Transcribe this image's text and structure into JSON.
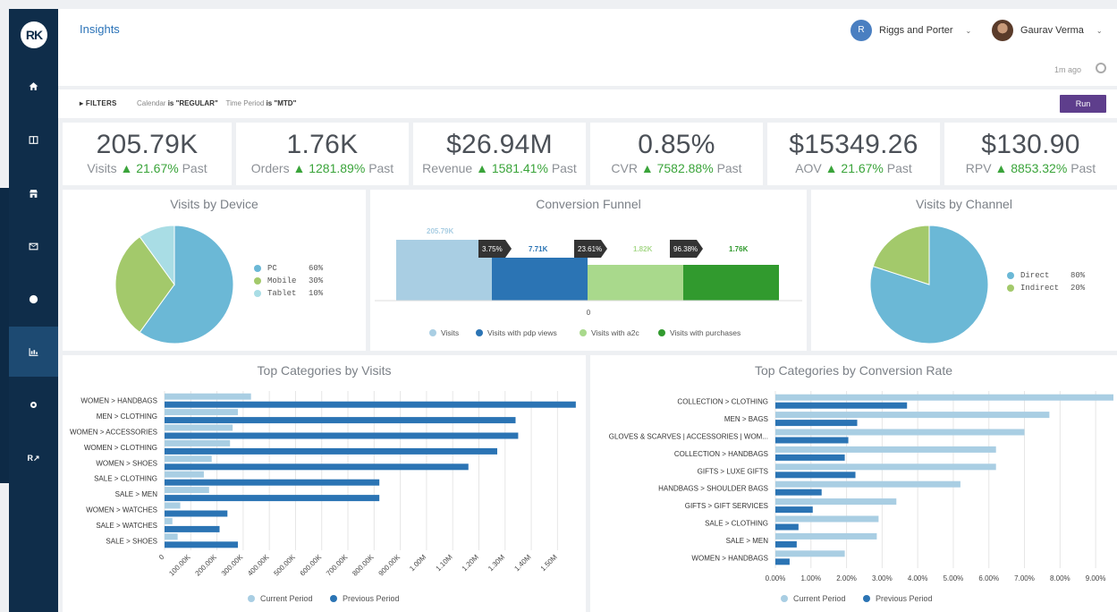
{
  "app": {
    "logo": "RK",
    "page_title": "Insights",
    "account_initial": "R",
    "account_name": "Riggs and Porter",
    "user_name": "Gaurav Verma",
    "updated": "1m ago"
  },
  "sidebar": {
    "items": [
      {
        "icon": "home-icon"
      },
      {
        "icon": "dashboard-icon"
      },
      {
        "icon": "store-icon"
      },
      {
        "icon": "mail-icon"
      },
      {
        "icon": "globe-icon"
      },
      {
        "icon": "chart-icon"
      },
      {
        "icon": "gear-icon"
      },
      {
        "icon": "report-link-icon",
        "label": "R↗"
      }
    ]
  },
  "filters": {
    "label": "FILTERS",
    "calendar_label": "Calendar",
    "calendar_is": "is \"REGULAR\"",
    "period_label": "Time Period",
    "period_is": "is \"MTD\"",
    "run_label": "Run"
  },
  "kpis": [
    {
      "value": "205.79K",
      "label": "Visits",
      "delta": "▲ 21.67%",
      "suffix": "Past"
    },
    {
      "value": "1.76K",
      "label": "Orders",
      "delta": "▲ 1281.89%",
      "suffix": "Past"
    },
    {
      "value": "$26.94M",
      "label": "Revenue",
      "delta": "▲ 1581.41%",
      "suffix": "Past"
    },
    {
      "value": "0.85%",
      "label": "CVR",
      "delta": "▲ 7582.88%",
      "suffix": "Past"
    },
    {
      "value": "$15349.26",
      "label": "AOV",
      "delta": "▲ 21.67%",
      "suffix": "Past"
    },
    {
      "value": "$130.90",
      "label": "RPV",
      "delta": "▲ 8853.32%",
      "suffix": "Past"
    }
  ],
  "colors": {
    "light_blue": "#a9cee3",
    "blue": "#2b74b4",
    "light_green": "#a9d98c",
    "green": "#319a2e",
    "pie_blue": "#6bb8d6",
    "pie_green": "#a3c96b",
    "pie_light": "#a9dde5",
    "up": "#3aa43a"
  },
  "chart_data": [
    {
      "type": "pie",
      "title": "Visits by Device",
      "slices": [
        {
          "name": "PC",
          "pct": "60%",
          "value": 60
        },
        {
          "name": "Mobile",
          "pct": "30%",
          "value": 30
        },
        {
          "name": "Tablet",
          "pct": "10%",
          "value": 10
        }
      ]
    },
    {
      "type": "bar",
      "title": "Conversion Funnel",
      "categories": [
        "Visits",
        "Visits with pdp views",
        "Visits with a2c",
        "Visits with purchases"
      ],
      "value_labels": [
        "205.79K",
        "7.71K",
        "1.82K",
        "1.76K"
      ],
      "rates": [
        "3.75%",
        "23.61%",
        "96.38%"
      ],
      "axis_zero": "0"
    },
    {
      "type": "pie",
      "title": "Visits by Channel",
      "slices": [
        {
          "name": "Direct",
          "pct": "80%",
          "value": 80
        },
        {
          "name": "Indirect",
          "pct": "20%",
          "value": 20
        }
      ]
    },
    {
      "type": "bar",
      "orientation": "horizontal",
      "title": "Top Categories by Visits",
      "categories": [
        "WOMEN > HANDBAGS",
        "MEN > CLOTHING",
        "WOMEN > ACCESSORIES",
        "WOMEN > CLOTHING",
        "WOMEN > SHOES",
        "SALE > CLOTHING",
        "SALE > MEN",
        "WOMEN > WATCHES",
        "SALE > WATCHES",
        "SALE > SHOES"
      ],
      "series": [
        {
          "name": "Current Period",
          "values": [
            330000,
            280000,
            260000,
            250000,
            180000,
            150000,
            170000,
            60000,
            30000,
            50000
          ]
        },
        {
          "name": "Previous Period",
          "values": [
            1570000,
            1340000,
            1350000,
            1270000,
            1160000,
            820000,
            820000,
            240000,
            210000,
            280000
          ]
        }
      ],
      "xlim": [
        0,
        1550000
      ],
      "ticks": [
        "0",
        "100.00K",
        "200.00K",
        "300.00K",
        "400.00K",
        "500.00K",
        "600.00K",
        "700.00K",
        "800.00K",
        "900.00K",
        "1.00M",
        "1.10M",
        "1.20M",
        "1.30M",
        "1.40M",
        "1.50M"
      ]
    },
    {
      "type": "bar",
      "orientation": "horizontal",
      "title": "Top Categories by Conversion Rate",
      "categories": [
        "COLLECTION > CLOTHING",
        "MEN > BAGS",
        "GLOVES & SCARVES | ACCESSORIES | WOM...",
        "COLLECTION > HANDBAGS",
        "GIFTS > LUXE GIFTS",
        "HANDBAGS > SHOULDER BAGS",
        "GIFTS > GIFT SERVICES",
        "SALE > CLOTHING",
        "SALE > MEN",
        "WOMEN > HANDBAGS"
      ],
      "series": [
        {
          "name": "Current Period",
          "values": [
            9.5,
            7.7,
            7.0,
            6.2,
            6.2,
            5.2,
            3.4,
            2.9,
            2.85,
            1.95
          ]
        },
        {
          "name": "Previous Period",
          "values": [
            3.7,
            2.3,
            2.05,
            1.95,
            2.25,
            1.3,
            1.05,
            0.65,
            0.6,
            0.4
          ]
        }
      ],
      "xlim": [
        0,
        9.5
      ],
      "ticks": [
        "0.00%",
        "1.00%",
        "2.00%",
        "3.00%",
        "4.00%",
        "5.00%",
        "6.00%",
        "7.00%",
        "8.00%",
        "9.00%"
      ]
    }
  ]
}
